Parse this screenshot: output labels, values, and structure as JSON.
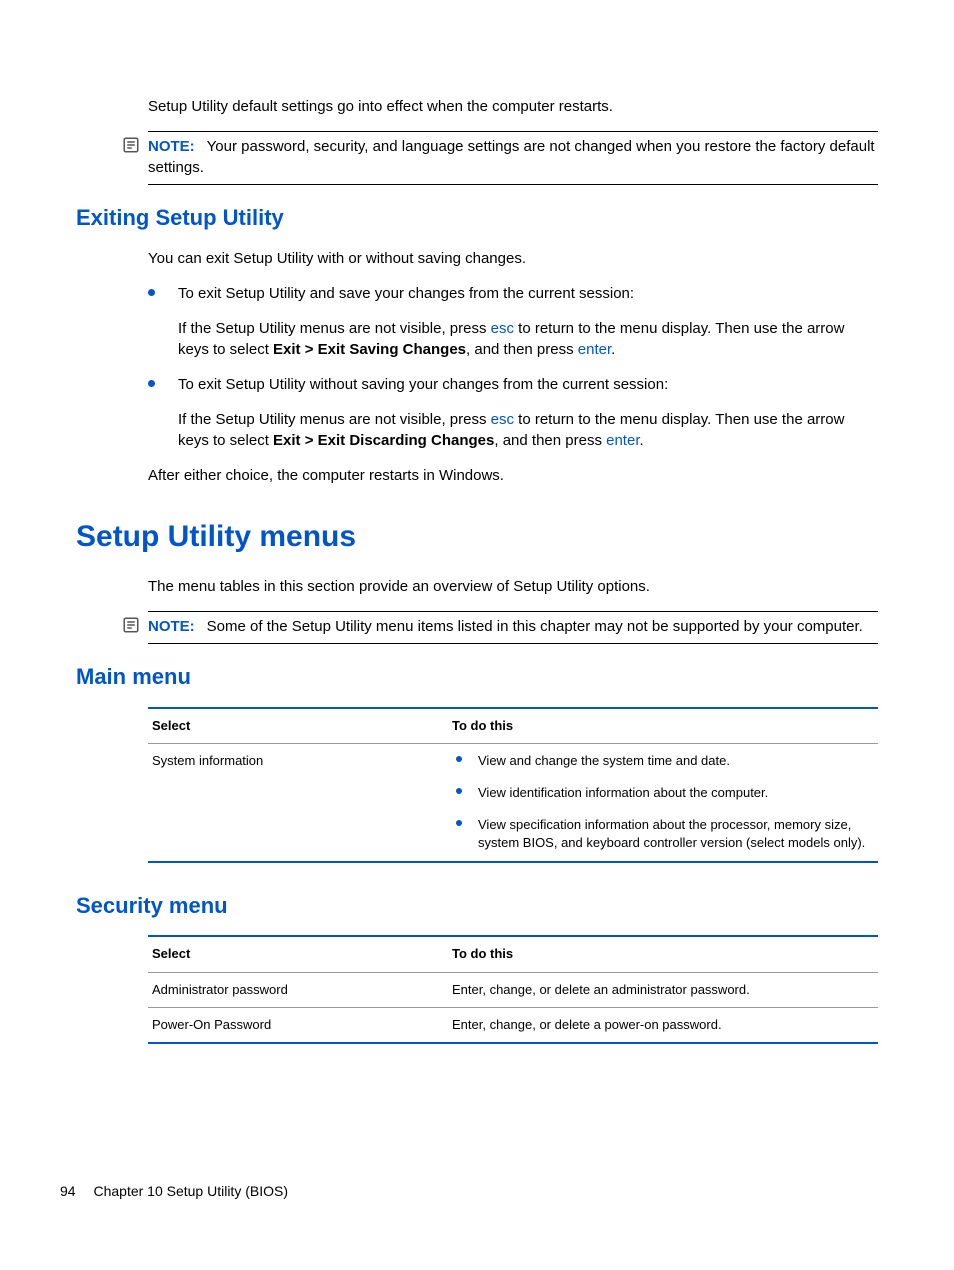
{
  "intro_para": "Setup Utility default settings go into effect when the computer restarts.",
  "note1": {
    "label": "NOTE:",
    "text": "Your password, security, and language settings are not changed when you restore the factory default settings."
  },
  "section_exit": {
    "heading": "Exiting Setup Utility",
    "intro": "You can exit Setup Utility with or without saving changes.",
    "bullets": [
      {
        "lead": "To exit Setup Utility and save your changes from the current session:",
        "sub_a": "If the Setup Utility menus are not visible, press ",
        "key1": "esc",
        "sub_b": " to return to the menu display. Then use the arrow keys to select ",
        "bold": "Exit > Exit Saving Changes",
        "sub_c": ", and then press ",
        "key2": "enter",
        "sub_d": "."
      },
      {
        "lead": "To exit Setup Utility without saving your changes from the current session:",
        "sub_a": "If the Setup Utility menus are not visible, press ",
        "key1": "esc",
        "sub_b": " to return to the menu display. Then use the arrow keys to select ",
        "bold": "Exit > Exit Discarding Changes",
        "sub_c": ", and then press ",
        "key2": "enter",
        "sub_d": "."
      }
    ],
    "outro": "After either choice, the computer restarts in Windows."
  },
  "section_menus": {
    "heading": "Setup Utility menus",
    "intro": "The menu tables in this section provide an overview of Setup Utility options.",
    "note": {
      "label": "NOTE:",
      "text": "Some of the Setup Utility menu items listed in this chapter may not be supported by your computer."
    }
  },
  "main_menu": {
    "heading": "Main menu",
    "col1": "Select",
    "col2": "To do this",
    "rows": [
      {
        "select": "System information",
        "items": [
          "View and change the system time and date.",
          "View identification information about the computer.",
          "View specification information about the processor, memory size, system BIOS, and keyboard controller version (select models only)."
        ]
      }
    ]
  },
  "security_menu": {
    "heading": "Security menu",
    "col1": "Select",
    "col2": "To do this",
    "rows": [
      {
        "select": "Administrator password",
        "todo": "Enter, change, or delete an administrator password."
      },
      {
        "select": "Power-On Password",
        "todo": "Enter, change, or delete a power-on password."
      }
    ]
  },
  "footer": {
    "page": "94",
    "chapter": "Chapter 10   Setup Utility (BIOS)"
  }
}
